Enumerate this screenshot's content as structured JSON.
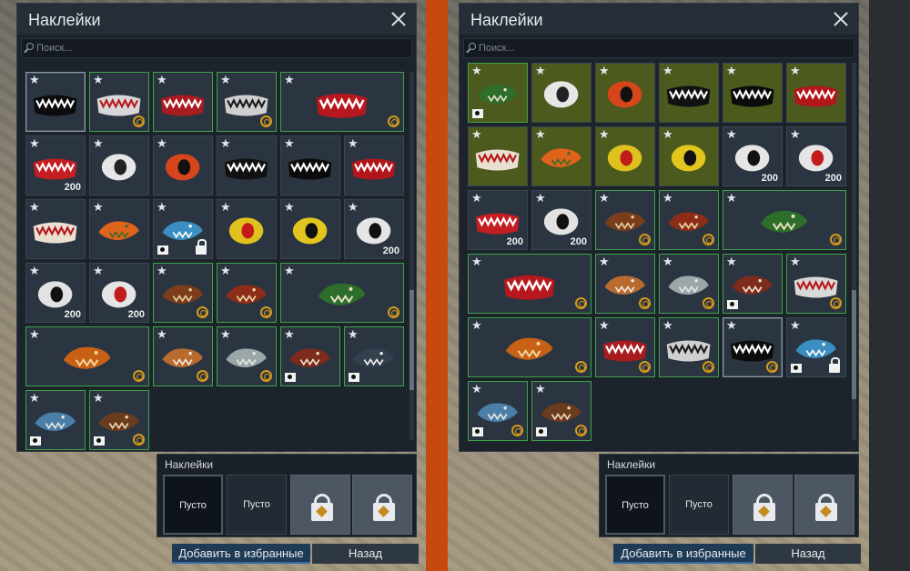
{
  "left": {
    "title": "Наклейки",
    "search_placeholder": "Поиск...",
    "tiles": [
      {
        "r": 0,
        "c": 0,
        "w": 1,
        "star": "★",
        "owned": false,
        "sel": true,
        "price": "",
        "coin": false,
        "tag": false,
        "lock": false,
        "motif": "shark-mouth-black",
        "fill": "#0c0c0c",
        "accent": "#ffffff"
      },
      {
        "r": 0,
        "c": 1,
        "w": 1,
        "star": "★",
        "owned": true,
        "price": "",
        "coin": true,
        "tag": false,
        "lock": false,
        "motif": "shark-mouth-white",
        "fill": "#d8d8d8",
        "accent": "#b8191c"
      },
      {
        "r": 0,
        "c": 2,
        "w": 1,
        "star": "★",
        "owned": true,
        "price": "",
        "coin": false,
        "tag": false,
        "lock": false,
        "motif": "shark-mouth-red",
        "fill": "#a81c20",
        "accent": "#ffffff"
      },
      {
        "r": 0,
        "c": 3,
        "w": 1,
        "star": "★",
        "owned": true,
        "price": "",
        "coin": true,
        "tag": false,
        "lock": false,
        "motif": "shark-mouth-white2",
        "fill": "#cfcfcf",
        "accent": "#1a1a1a"
      },
      {
        "r": 0,
        "c": 4,
        "w": 2,
        "star": "★",
        "owned": true,
        "price": "",
        "coin": true,
        "tag": false,
        "lock": false,
        "motif": "long-shark-mouth",
        "fill": "#b7181e",
        "accent": "#ffffff"
      },
      {
        "r": 1,
        "c": 0,
        "w": 1,
        "star": "★",
        "owned": false,
        "price": "200",
        "coin": false,
        "tag": false,
        "lock": false,
        "motif": "shark-mouth-grey",
        "fill": "#c41d22",
        "accent": "#ffffff"
      },
      {
        "r": 1,
        "c": 1,
        "w": 1,
        "star": "★",
        "owned": false,
        "price": "",
        "coin": false,
        "tag": false,
        "lock": false,
        "motif": "white-eye",
        "fill": "#e6e6e6",
        "accent": "#222222"
      },
      {
        "r": 1,
        "c": 2,
        "w": 1,
        "star": "★",
        "owned": false,
        "price": "",
        "coin": false,
        "tag": false,
        "lock": false,
        "motif": "red-eye",
        "fill": "#d7461b",
        "accent": "#111111"
      },
      {
        "r": 1,
        "c": 3,
        "w": 1,
        "star": "★",
        "owned": false,
        "price": "",
        "coin": false,
        "tag": false,
        "lock": false,
        "motif": "shark-teeth-black",
        "fill": "#111111",
        "accent": "#ffffff"
      },
      {
        "r": 1,
        "c": 4,
        "w": 1,
        "star": "★",
        "owned": false,
        "price": "",
        "coin": false,
        "tag": false,
        "lock": false,
        "motif": "shark-teeth-black2",
        "fill": "#0b0b0b",
        "accent": "#ffffff"
      },
      {
        "r": 1,
        "c": 5,
        "w": 1,
        "star": "★",
        "owned": false,
        "price": "",
        "coin": false,
        "tag": false,
        "lock": false,
        "motif": "shark-teeth-red",
        "fill": "#b2161b",
        "accent": "#ffffff"
      },
      {
        "r": 2,
        "c": 0,
        "w": 1,
        "star": "★",
        "owned": false,
        "price": "",
        "coin": false,
        "tag": false,
        "lock": false,
        "motif": "fang-jaw",
        "fill": "#e9e0d2",
        "accent": "#b5171b"
      },
      {
        "r": 2,
        "c": 1,
        "w": 1,
        "star": "★",
        "owned": false,
        "price": "",
        "coin": false,
        "tag": false,
        "lock": false,
        "motif": "eagle-head",
        "fill": "#e0631b",
        "accent": "#3f6b2a"
      },
      {
        "r": 2,
        "c": 2,
        "w": 1,
        "star": "★",
        "owned": false,
        "price": "",
        "coin": false,
        "tag": true,
        "lock": true,
        "motif": "blue-shark",
        "fill": "#3a8ec2",
        "accent": "#ffffff"
      },
      {
        "r": 2,
        "c": 3,
        "w": 1,
        "star": "★",
        "owned": false,
        "price": "",
        "coin": false,
        "tag": false,
        "lock": false,
        "motif": "yellow-eye-slit",
        "fill": "#e0c21e",
        "accent": "#c11b1b"
      },
      {
        "r": 2,
        "c": 4,
        "w": 1,
        "star": "★",
        "owned": false,
        "price": "",
        "coin": false,
        "tag": false,
        "lock": false,
        "motif": "yellow-eye",
        "fill": "#e2c61e",
        "accent": "#111111"
      },
      {
        "r": 2,
        "c": 5,
        "w": 1,
        "star": "★",
        "owned": false,
        "price": "200",
        "coin": false,
        "tag": false,
        "lock": false,
        "motif": "white-eye-big",
        "fill": "#e5e5e5",
        "accent": "#111111"
      },
      {
        "r": 3,
        "c": 0,
        "w": 1,
        "star": "★",
        "owned": false,
        "price": "200",
        "coin": false,
        "tag": false,
        "lock": false,
        "motif": "white-eye-2",
        "fill": "#e2e2e2",
        "accent": "#111111"
      },
      {
        "r": 3,
        "c": 1,
        "w": 1,
        "star": "★",
        "owned": false,
        "price": "200",
        "coin": false,
        "tag": false,
        "lock": false,
        "motif": "red-eye-2",
        "fill": "#e5e5e5",
        "accent": "#c21b1b"
      },
      {
        "r": 3,
        "c": 2,
        "w": 1,
        "star": "★",
        "owned": true,
        "price": "",
        "coin": true,
        "tag": false,
        "lock": false,
        "motif": "bear-head",
        "fill": "#7c3d1b",
        "accent": "#e0cfa0"
      },
      {
        "r": 3,
        "c": 3,
        "w": 1,
        "star": "★",
        "owned": true,
        "price": "",
        "coin": true,
        "tag": false,
        "lock": false,
        "motif": "boar-head",
        "fill": "#8e2d17",
        "accent": "#e8d5a8"
      },
      {
        "r": 3,
        "c": 4,
        "w": 2,
        "star": "★",
        "owned": true,
        "price": "",
        "coin": true,
        "tag": false,
        "lock": false,
        "motif": "crocodile",
        "fill": "#2d6e2a",
        "accent": "#e9e0c4"
      },
      {
        "r": 4,
        "c": 0,
        "w": 2,
        "star": "★",
        "owned": true,
        "price": "",
        "coin": true,
        "tag": false,
        "lock": false,
        "motif": "snake-head",
        "fill": "#c86116",
        "accent": "#f1d8a0"
      },
      {
        "r": 4,
        "c": 2,
        "w": 1,
        "star": "★",
        "owned": true,
        "price": "",
        "coin": true,
        "tag": false,
        "lock": false,
        "motif": "tiger-head",
        "fill": "#b96a2f",
        "accent": "#efe6da"
      },
      {
        "r": 4,
        "c": 3,
        "w": 1,
        "star": "★",
        "owned": true,
        "price": "",
        "coin": true,
        "tag": false,
        "lock": false,
        "motif": "wolf-head",
        "fill": "#9aa6a8",
        "accent": "#e0e6e6"
      },
      {
        "r": 4,
        "c": 4,
        "w": 1,
        "star": "★",
        "owned": true,
        "price": "",
        "coin": false,
        "tag": true,
        "lock": false,
        "motif": "lamprey",
        "fill": "#7c2b1c",
        "accent": "#f0e0c8"
      },
      {
        "r": 4,
        "c": 5,
        "w": 1,
        "star": "★",
        "owned": true,
        "price": "",
        "coin": false,
        "tag": true,
        "lock": false,
        "motif": "dark-shark",
        "fill": "#33414f",
        "accent": "#f0f0f0"
      },
      {
        "r": 5,
        "c": 0,
        "w": 1,
        "star": "★",
        "owned": true,
        "price": "",
        "coin": false,
        "tag": true,
        "lock": false,
        "motif": "blue-fish",
        "fill": "#4b7fa8",
        "accent": "#e6e6e6"
      },
      {
        "r": 5,
        "c": 1,
        "w": 1,
        "star": "★",
        "owned": true,
        "price": "",
        "coin": true,
        "tag": true,
        "lock": false,
        "motif": "brown-creature",
        "fill": "#6b3b1d",
        "accent": "#e8d8b4"
      }
    ],
    "slots_label": "Наклейки",
    "slots": [
      "Пусто",
      "Пусто"
    ],
    "fav_button": "Добавить в избранные",
    "back_button": "Назад"
  },
  "right": {
    "title": "Наклейки",
    "search_placeholder": "Поиск...",
    "tiles": [
      {
        "r": 0,
        "c": 0,
        "w": 1,
        "star": "★",
        "owned": true,
        "olive": true,
        "price": "",
        "coin": false,
        "tag": true,
        "lock": false,
        "motif": "croc-olive",
        "fill": "#2d6e2a",
        "accent": "#e9e0c4"
      },
      {
        "r": 0,
        "c": 1,
        "w": 1,
        "star": "★",
        "olive": true,
        "price": "",
        "coin": false,
        "tag": false,
        "lock": false,
        "motif": "white-eye",
        "fill": "#e6e6e6",
        "accent": "#222222"
      },
      {
        "r": 0,
        "c": 2,
        "w": 1,
        "star": "★",
        "olive": true,
        "price": "",
        "coin": false,
        "tag": false,
        "lock": false,
        "motif": "red-eye",
        "fill": "#d7461b",
        "accent": "#111111"
      },
      {
        "r": 0,
        "c": 3,
        "w": 1,
        "star": "★",
        "olive": true,
        "price": "",
        "coin": false,
        "tag": false,
        "lock": false,
        "motif": "shark-teeth-black",
        "fill": "#111111",
        "accent": "#ffffff"
      },
      {
        "r": 0,
        "c": 4,
        "w": 1,
        "star": "★",
        "olive": true,
        "price": "",
        "coin": false,
        "tag": false,
        "lock": false,
        "motif": "shark-teeth-black2",
        "fill": "#0b0b0b",
        "accent": "#ffffff"
      },
      {
        "r": 0,
        "c": 5,
        "w": 1,
        "star": "★",
        "olive": true,
        "price": "",
        "coin": false,
        "tag": false,
        "lock": false,
        "motif": "shark-teeth-red",
        "fill": "#b2161b",
        "accent": "#ffffff"
      },
      {
        "r": 1,
        "c": 0,
        "w": 1,
        "star": "★",
        "olive": true,
        "price": "",
        "coin": false,
        "tag": false,
        "lock": false,
        "motif": "fang-jaw",
        "fill": "#e9e0d2",
        "accent": "#b5171b"
      },
      {
        "r": 1,
        "c": 1,
        "w": 1,
        "star": "★",
        "olive": true,
        "price": "",
        "coin": false,
        "tag": false,
        "lock": false,
        "motif": "eagle-head",
        "fill": "#e0631b",
        "accent": "#3f6b2a"
      },
      {
        "r": 1,
        "c": 2,
        "w": 1,
        "star": "★",
        "olive": true,
        "price": "",
        "coin": false,
        "tag": false,
        "lock": false,
        "motif": "yellow-eye-slit",
        "fill": "#e0c21e",
        "accent": "#c11b1b"
      },
      {
        "r": 1,
        "c": 3,
        "w": 1,
        "star": "★",
        "olive": true,
        "price": "",
        "coin": false,
        "tag": false,
        "lock": false,
        "motif": "yellow-eye",
        "fill": "#e2c61e",
        "accent": "#111111"
      },
      {
        "r": 1,
        "c": 4,
        "w": 1,
        "star": "★",
        "price": "200",
        "coin": false,
        "tag": false,
        "lock": false,
        "motif": "white-eye-big",
        "fill": "#e5e5e5",
        "accent": "#111111"
      },
      {
        "r": 1,
        "c": 5,
        "w": 1,
        "star": "★",
        "price": "200",
        "coin": false,
        "tag": false,
        "lock": false,
        "motif": "red-eye-2",
        "fill": "#e5e5e5",
        "accent": "#c21b1b"
      },
      {
        "r": 2,
        "c": 0,
        "w": 1,
        "star": "★",
        "price": "200",
        "coin": false,
        "tag": false,
        "lock": false,
        "motif": "shark-mouth-grey",
        "fill": "#c41d22",
        "accent": "#ffffff"
      },
      {
        "r": 2,
        "c": 1,
        "w": 1,
        "star": "★",
        "price": "200",
        "coin": false,
        "tag": false,
        "lock": false,
        "motif": "white-eye-2",
        "fill": "#e2e2e2",
        "accent": "#111111"
      },
      {
        "r": 2,
        "c": 2,
        "w": 1,
        "star": "★",
        "owned": true,
        "price": "",
        "coin": true,
        "tag": false,
        "lock": false,
        "motif": "bear-head",
        "fill": "#7c3d1b",
        "accent": "#e0cfa0"
      },
      {
        "r": 2,
        "c": 3,
        "w": 1,
        "star": "★",
        "owned": true,
        "price": "",
        "coin": true,
        "tag": false,
        "lock": false,
        "motif": "boar-head",
        "fill": "#8e2d17",
        "accent": "#e8d5a8"
      },
      {
        "r": 2,
        "c": 4,
        "w": 2,
        "star": "★",
        "owned": true,
        "price": "",
        "coin": true,
        "tag": false,
        "lock": false,
        "motif": "crocodile",
        "fill": "#2d6e2a",
        "accent": "#e9e0c4"
      },
      {
        "r": 3,
        "c": 0,
        "w": 2,
        "star": "★",
        "owned": true,
        "price": "",
        "coin": true,
        "tag": false,
        "lock": false,
        "motif": "long-shark-mouth",
        "fill": "#b7181e",
        "accent": "#ffffff"
      },
      {
        "r": 3,
        "c": 2,
        "w": 1,
        "star": "★",
        "owned": true,
        "price": "",
        "coin": true,
        "tag": false,
        "lock": false,
        "motif": "tiger-head",
        "fill": "#b96a2f",
        "accent": "#efe6da"
      },
      {
        "r": 3,
        "c": 3,
        "w": 1,
        "star": "★",
        "owned": true,
        "price": "",
        "coin": true,
        "tag": false,
        "lock": false,
        "motif": "wolf-head",
        "fill": "#9aa6a8",
        "accent": "#e0e6e6"
      },
      {
        "r": 3,
        "c": 4,
        "w": 1,
        "star": "★",
        "owned": true,
        "price": "",
        "coin": false,
        "tag": true,
        "lock": false,
        "motif": "lamprey",
        "fill": "#7c2b1c",
        "accent": "#f0e0c8"
      },
      {
        "r": 3,
        "c": 5,
        "w": 1,
        "star": "★",
        "owned": true,
        "price": "",
        "coin": true,
        "tag": false,
        "lock": false,
        "motif": "shark-mouth-white",
        "fill": "#d8d8d8",
        "accent": "#b8191c"
      },
      {
        "r": 4,
        "c": 0,
        "w": 2,
        "star": "★",
        "owned": true,
        "price": "",
        "coin": true,
        "tag": false,
        "lock": false,
        "motif": "snake-head",
        "fill": "#c86116",
        "accent": "#f1d8a0"
      },
      {
        "r": 4,
        "c": 2,
        "w": 1,
        "star": "★",
        "owned": true,
        "price": "",
        "coin": true,
        "tag": false,
        "lock": false,
        "motif": "shark-mouth-red",
        "fill": "#a81c20",
        "accent": "#ffffff"
      },
      {
        "r": 4,
        "c": 3,
        "w": 1,
        "star": "★",
        "owned": true,
        "price": "",
        "coin": true,
        "tag": false,
        "lock": false,
        "motif": "shark-mouth-white2",
        "fill": "#cfcfcf",
        "accent": "#1a1a1a"
      },
      {
        "r": 4,
        "c": 4,
        "w": 1,
        "star": "★",
        "owned": false,
        "sel": true,
        "price": "",
        "coin": true,
        "tag": false,
        "lock": false,
        "motif": "shark-mouth-black",
        "fill": "#0c0c0c",
        "accent": "#ffffff"
      },
      {
        "r": 4,
        "c": 5,
        "w": 1,
        "star": "★",
        "owned": false,
        "price": "",
        "coin": false,
        "tag": true,
        "lock": true,
        "motif": "blue-shark",
        "fill": "#3a8ec2",
        "accent": "#ffffff"
      },
      {
        "r": 5,
        "c": 0,
        "w": 1,
        "star": "★",
        "owned": true,
        "price": "",
        "coin": true,
        "tag": true,
        "lock": false,
        "motif": "blue-fish",
        "fill": "#4b7fa8",
        "accent": "#e6e6e6"
      },
      {
        "r": 5,
        "c": 1,
        "w": 1,
        "star": "★",
        "owned": true,
        "price": "",
        "coin": true,
        "tag": true,
        "lock": false,
        "motif": "brown-creature",
        "fill": "#6b3b1d",
        "accent": "#e8d8b4"
      }
    ],
    "slots_label": "Наклейки",
    "slots": [
      "Пусто",
      "Пусто"
    ],
    "fav_button": "Добавить в избранные",
    "back_button": "Назад"
  }
}
